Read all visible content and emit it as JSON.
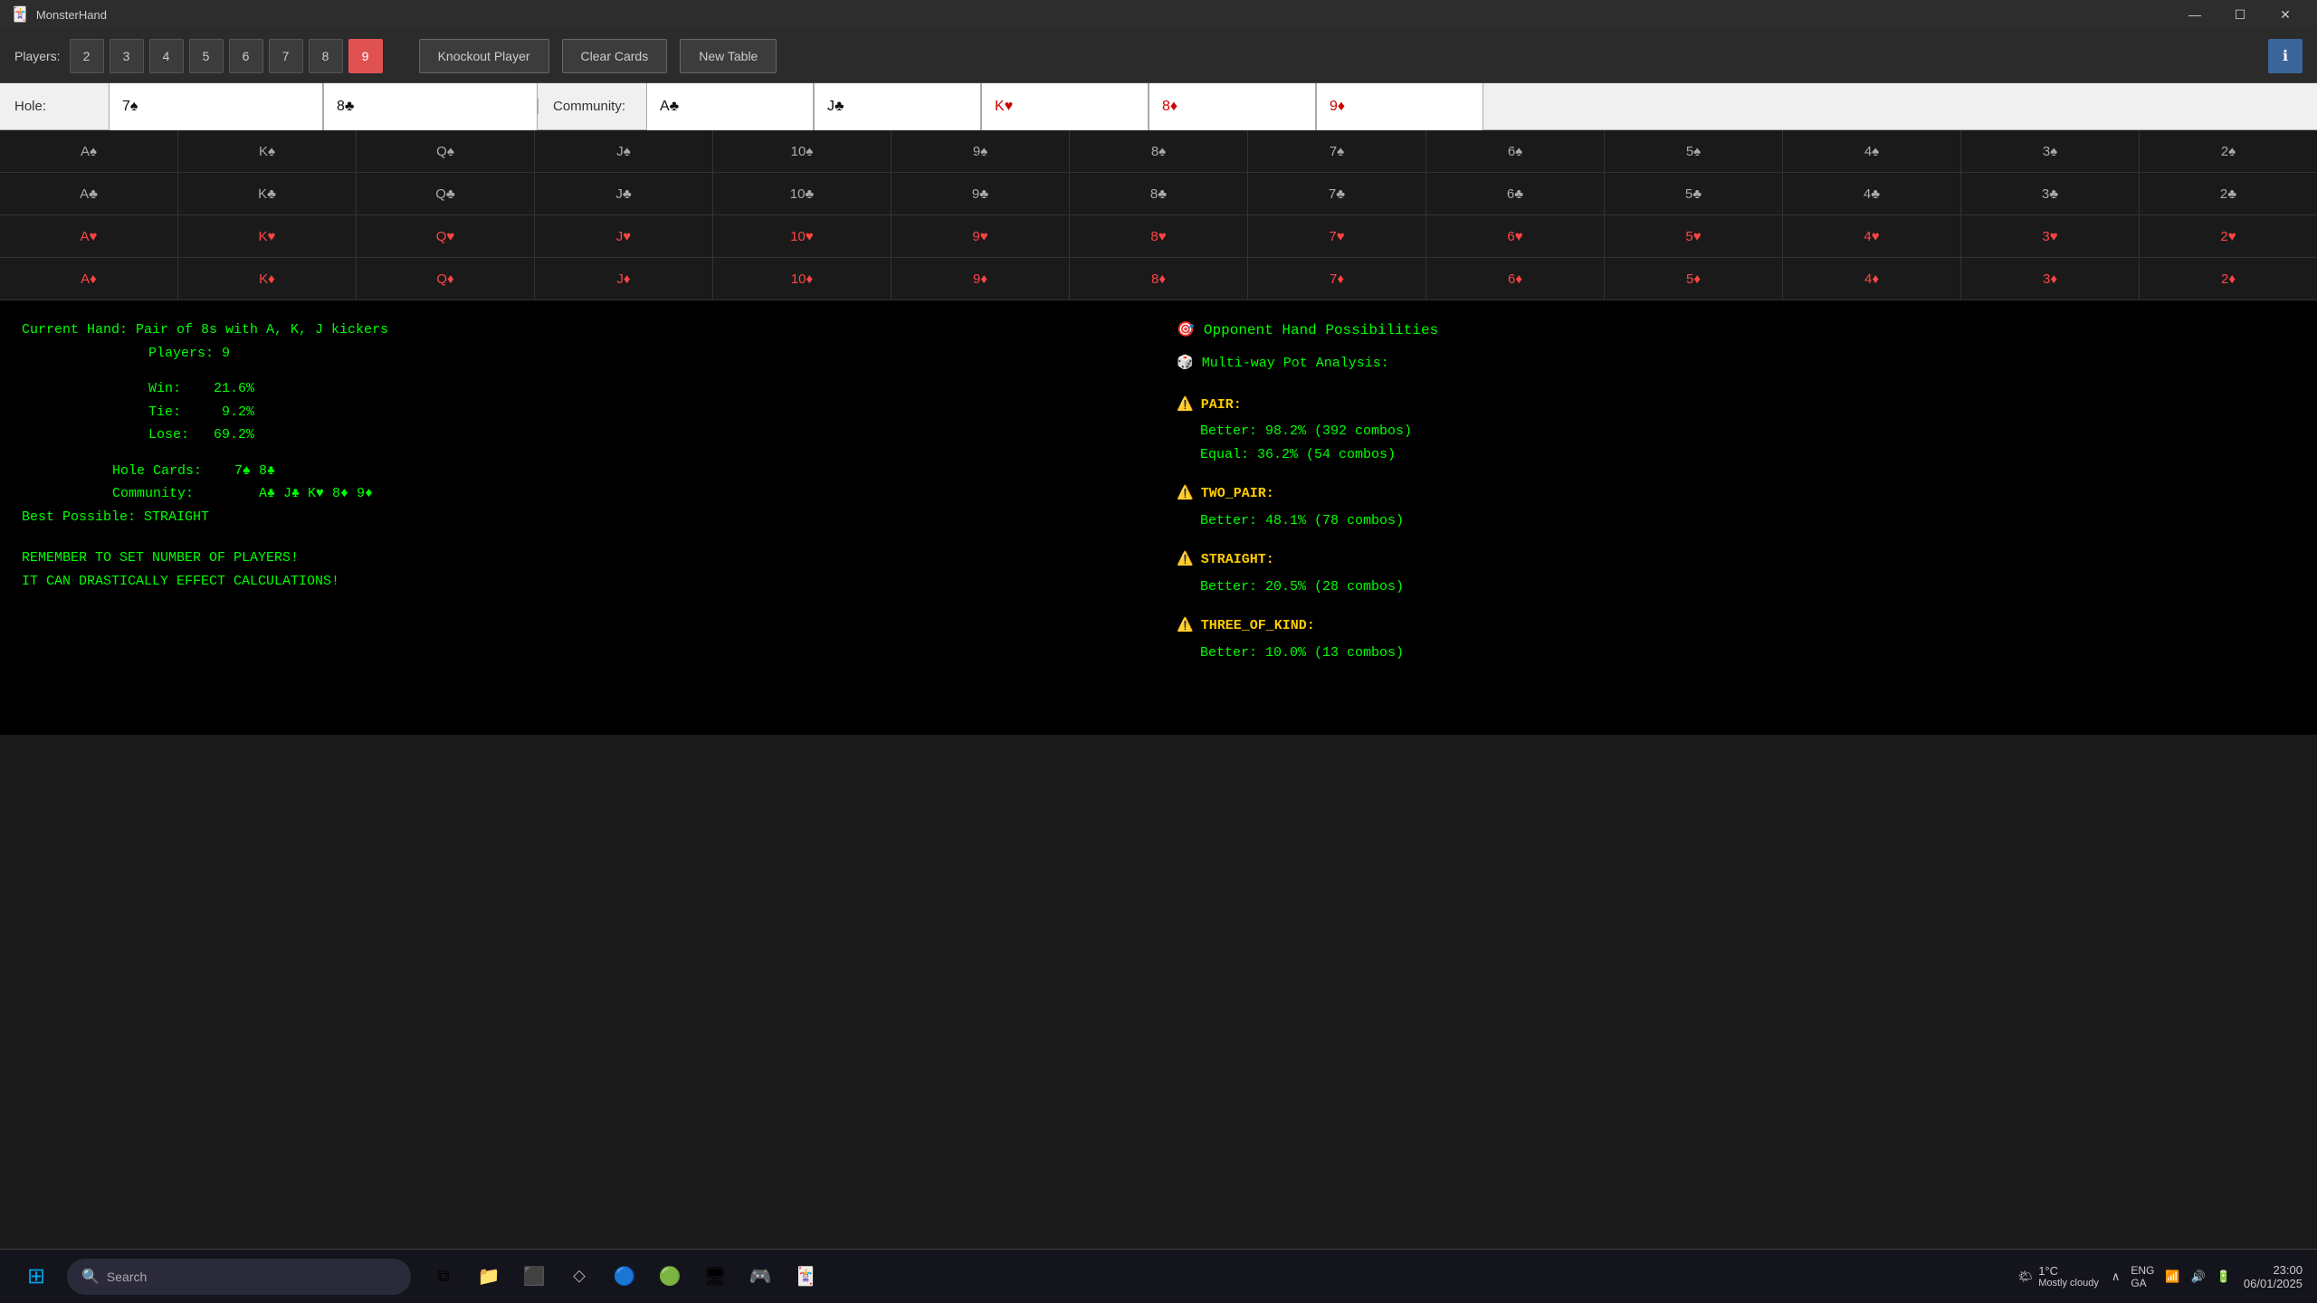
{
  "app": {
    "title": "MonsterHand",
    "icon": "🃏"
  },
  "titlebar": {
    "minimize": "—",
    "maximize": "☐",
    "close": "✕"
  },
  "toolbar": {
    "players_label": "Players:",
    "player_buttons": [
      "2",
      "3",
      "4",
      "5",
      "6",
      "7",
      "8",
      "9"
    ],
    "active_player": "9",
    "knockout_label": "Knockout Player",
    "clear_label": "Clear Cards",
    "new_table_label": "New Table",
    "info_label": "ℹ"
  },
  "hole": {
    "label": "Hole:",
    "card1": "7♠",
    "card2": "8♣",
    "card1_color": "black",
    "card2_color": "black"
  },
  "community": {
    "label": "Community:",
    "card1": "A♣",
    "card2": "J♣",
    "card3": "K♥",
    "card4": "8♦",
    "card5": "9♦",
    "card1_color": "black",
    "card2_color": "black",
    "card3_color": "red",
    "card4_color": "red",
    "card5_color": "red"
  },
  "card_rows": [
    {
      "suit": "spades",
      "color": "black",
      "cards": [
        "A♠",
        "K♠",
        "Q♠",
        "J♠",
        "10♠",
        "9♠",
        "8♠",
        "7♠",
        "6♠",
        "5♠",
        "4♠",
        "3♠",
        "2♠"
      ]
    },
    {
      "suit": "clubs",
      "color": "black",
      "cards": [
        "A♣",
        "K♣",
        "Q♣",
        "J♣",
        "10♣",
        "9♣",
        "8♣",
        "7♣",
        "6♣",
        "5♣",
        "4♣",
        "3♣",
        "2♣"
      ]
    },
    {
      "suit": "hearts",
      "color": "red",
      "cards": [
        "A♥",
        "K♥",
        "Q♥",
        "J♥",
        "10♥",
        "9♥",
        "8♥",
        "7♥",
        "6♥",
        "5♥",
        "4♥",
        "3♥",
        "2♥"
      ]
    },
    {
      "suit": "diamonds",
      "color": "red",
      "cards": [
        "A♦",
        "K♦",
        "Q♦",
        "J♦",
        "10♦",
        "9♦",
        "8♦",
        "7♦",
        "6♦",
        "5♦",
        "4♦",
        "3♦",
        "2♦"
      ]
    }
  ],
  "analysis": {
    "current_hand": "Current Hand: Pair of 8s with A, K, J kickers",
    "players": "Players: 9",
    "win_label": "Win:",
    "win_value": "21.6%",
    "tie_label": "Tie:",
    "tie_value": "9.2%",
    "lose_label": "Lose:",
    "lose_value": "69.2%",
    "hole_cards_label": "Hole Cards:",
    "hole_cards_value": "7♠ 8♣",
    "community_label": "Community:",
    "community_value": "A♣ J♣ K♥ 8♦ 9♦",
    "best_possible_label": "Best Possible:",
    "best_possible_value": "STRAIGHT",
    "reminder1": "REMEMBER TO SET NUMBER OF PLAYERS!",
    "reminder2": "IT CAN DRASTICALLY EFFECT CALCULATIONS!"
  },
  "opponent": {
    "title": "Opponent Hand Possibilities",
    "multiway_title": "Multi-way Pot Analysis:",
    "hands": [
      {
        "name": "PAIR:",
        "better": "Better: 98.2% (392 combos)",
        "equal": "Equal: 36.2% (54 combos)"
      },
      {
        "name": "TWO_PAIR:",
        "better": "Better: 48.1% (78 combos)"
      },
      {
        "name": "STRAIGHT:",
        "better": "Better: 20.5% (28 combos)"
      },
      {
        "name": "THREE_OF_KIND:",
        "better": "Better: 10.0% (13 combos)"
      }
    ]
  },
  "taskbar": {
    "search_placeholder": "Search",
    "time": "23:00",
    "date": "06/01/2025",
    "locale": "ENG",
    "region": "GA",
    "weather_temp": "1°C",
    "weather_desc": "Mostly cloudy"
  }
}
